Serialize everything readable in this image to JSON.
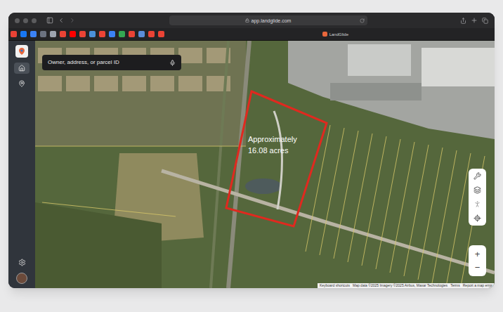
{
  "browser": {
    "url": "app.landglide.com",
    "tab_title": "LandGlide",
    "bookmarks": [
      {
        "color": "#ea4335"
      },
      {
        "color": "#1877f2"
      },
      {
        "color": "#3b82f6"
      },
      {
        "color": "#6b7280"
      },
      {
        "color": "#9ca3af"
      },
      {
        "color": "#ea4335"
      },
      {
        "color": "#ff0000"
      },
      {
        "color": "#ea4335"
      },
      {
        "color": "#4a90d9"
      },
      {
        "color": "#ea4335"
      },
      {
        "color": "#3b82f6"
      },
      {
        "color": "#34a853"
      },
      {
        "color": "#ea4335"
      },
      {
        "color": "#5b8dd9"
      },
      {
        "color": "#ea4335"
      },
      {
        "color": "#ea4335"
      }
    ]
  },
  "sidebar": {
    "items": [
      {
        "selected": true
      },
      {
        "selected": false
      }
    ]
  },
  "search": {
    "placeholder": "Owner, address, or parcel ID"
  },
  "map": {
    "annotation": [
      "Approximately",
      "16.08 acres"
    ],
    "zoom": [
      "+",
      "−"
    ],
    "attribution": [
      "Keyboard shortcuts",
      "Map data ©2025 Imagery ©2025 Airbus, Maxar Technologies",
      "Terms",
      "Report a map error"
    ]
  }
}
